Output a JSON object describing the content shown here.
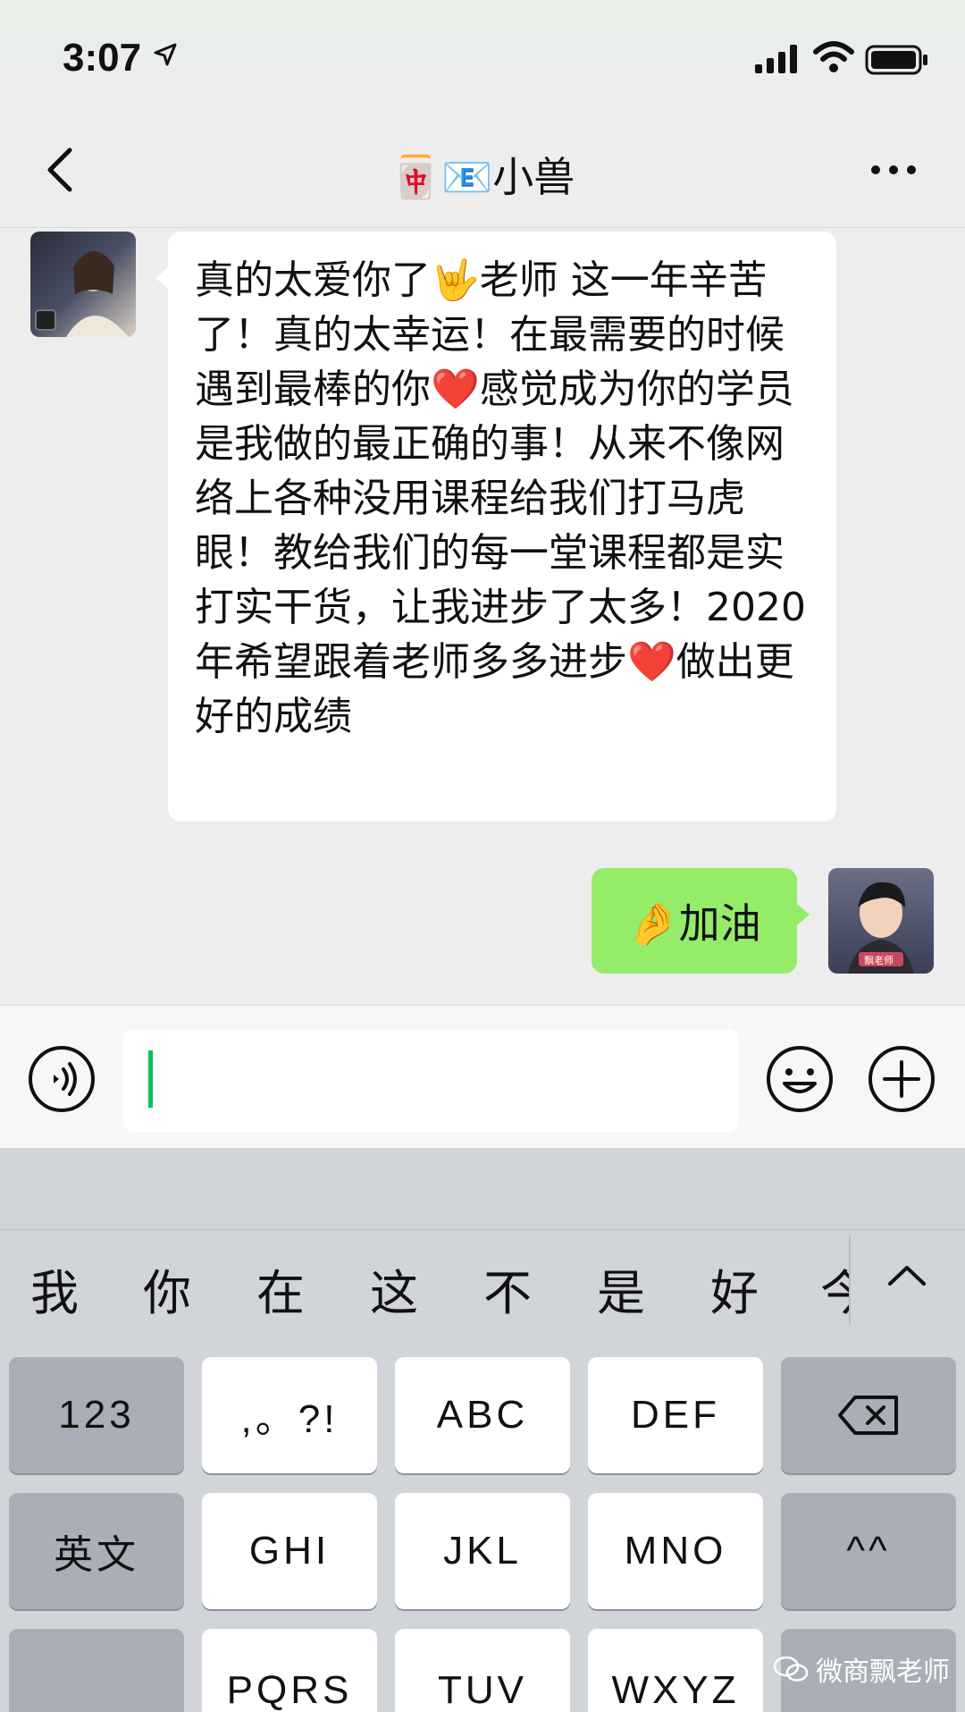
{
  "status": {
    "time": "3:07"
  },
  "nav": {
    "title": "🀄📧小兽"
  },
  "messages": {
    "incoming_text": "真的太爱你了🤟老师 这一年辛苦了！真的太幸运！在最需要的时候遇到最棒的你❤️感觉成为你的学员是我做的最正确的事！从来不像网络上各种没用课程给我们打马虎眼！教给我们的每一堂课程都是实打实干货，让我进步了太多！2020年希望跟着老师多多进步❤️做出更好的成绩",
    "outgoing_text": "🤌加油",
    "outgoing_avatar_label": "飘老师"
  },
  "input": {
    "value": ""
  },
  "keyboard": {
    "candidates": [
      "我",
      "你",
      "在",
      "这",
      "不",
      "是",
      "好",
      "今"
    ],
    "rows": [
      [
        "123",
        ",。?!",
        "ABC",
        "DEF",
        "⌫"
      ],
      [
        "英文",
        "GHI",
        "JKL",
        "MNO",
        "^^"
      ],
      [
        "",
        "PQRS",
        "TUV",
        "WXYZ",
        ""
      ]
    ]
  },
  "watermark": {
    "text": "微商飘老师"
  },
  "colors": {
    "background": "#ededed",
    "outgoing_bubble": "#95ec69",
    "incoming_bubble": "#ffffff",
    "cursor": "#07c160",
    "keyboard": "#d1d4d9"
  }
}
